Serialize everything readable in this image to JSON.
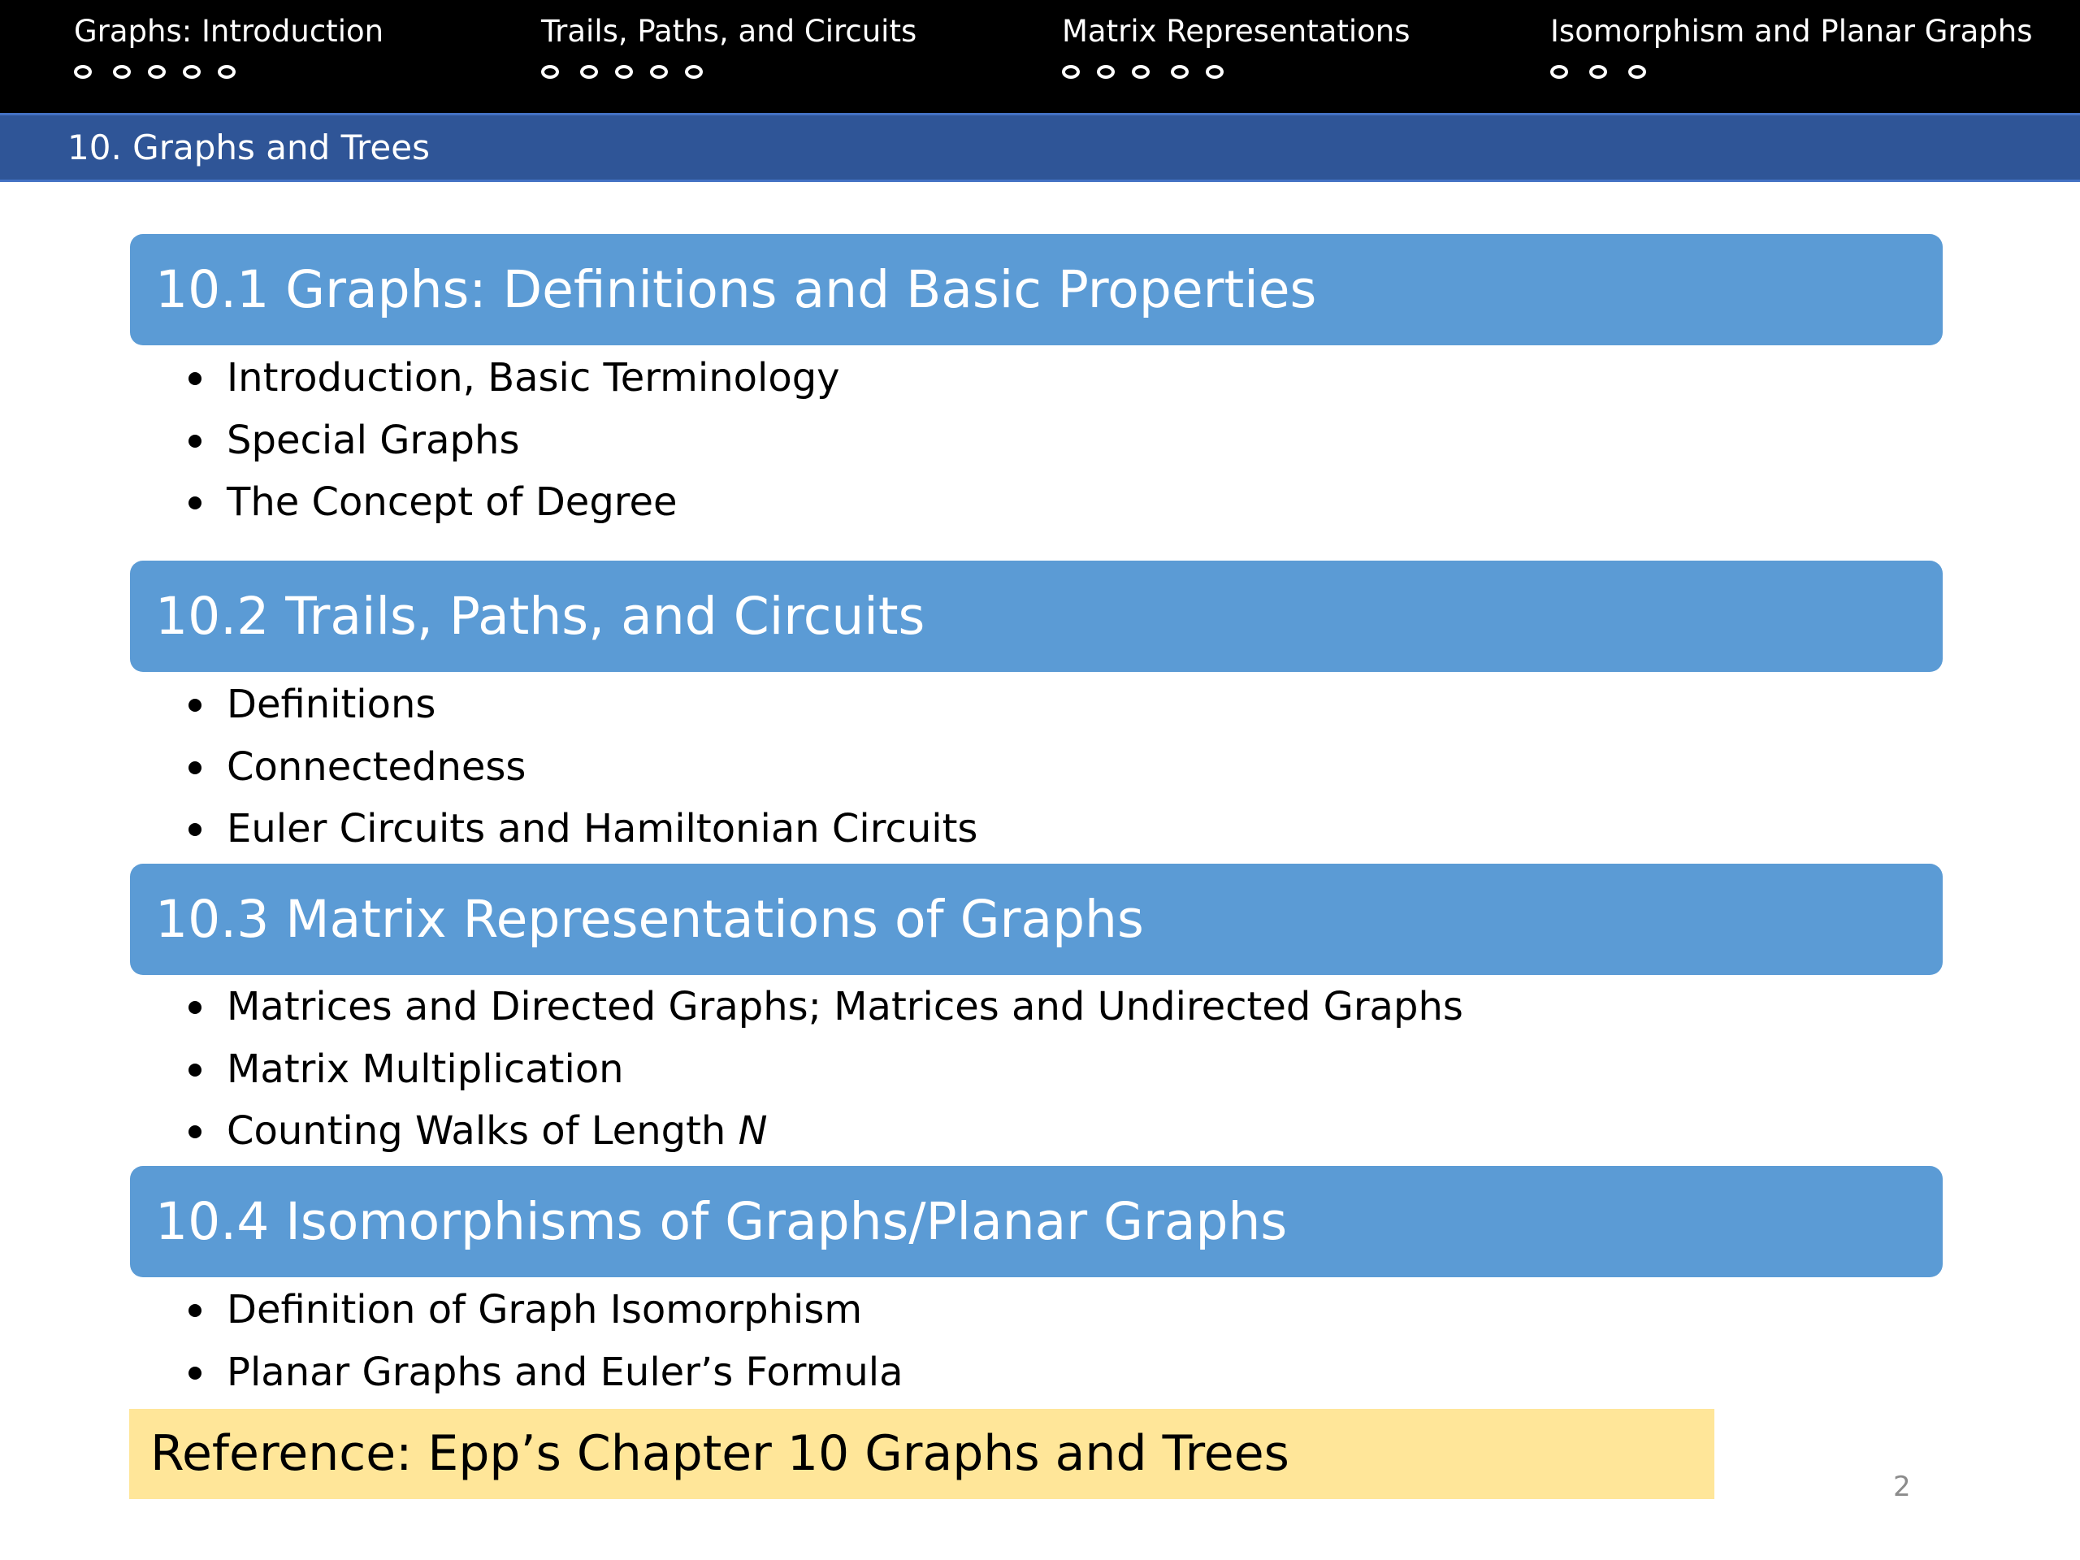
{
  "nav": {
    "sections": [
      {
        "title": "Graphs: Introduction",
        "dots": 5
      },
      {
        "title": "Trails, Paths, and Circuits",
        "dots": 5
      },
      {
        "title": "Matrix Representations",
        "dots": 5
      },
      {
        "title": "Isomorphism and Planar Graphs",
        "dots": 3
      }
    ]
  },
  "subtitle": "10. Graphs and Trees",
  "sections": [
    {
      "title": "10.1 Graphs: Definitions and Basic Properties",
      "items": [
        {
          "text": "Introduction, Basic Terminology"
        },
        {
          "text": "Special Graphs"
        },
        {
          "text": "The Concept of Degree"
        }
      ]
    },
    {
      "title": "10.2 Trails, Paths, and Circuits",
      "items": [
        {
          "text": "Definitions"
        },
        {
          "text": "Connectedness"
        },
        {
          "text": "Euler Circuits and Hamiltonian Circuits"
        }
      ]
    },
    {
      "title": "10.3 Matrix Representations of Graphs",
      "items": [
        {
          "text": "Matrices and Directed Graphs; Matrices and Undirected Graphs"
        },
        {
          "text": "Matrix Multiplication"
        },
        {
          "text": "Counting Walks of Length ",
          "italic": "N"
        }
      ]
    },
    {
      "title": "10.4 Isomorphisms of Graphs/Planar Graphs",
      "items": [
        {
          "text": "Definition of Graph Isomorphism"
        },
        {
          "text": "Planar Graphs and Euler’s Formula"
        }
      ]
    }
  ],
  "reference": "Reference: Epp’s Chapter 10 Graphs and Trees",
  "page_number": "2",
  "colors": {
    "nav_background": "#000000",
    "subtitle_bar": "#2f5597",
    "section_header": "#5b9bd5",
    "reference_box": "#ffe699"
  }
}
